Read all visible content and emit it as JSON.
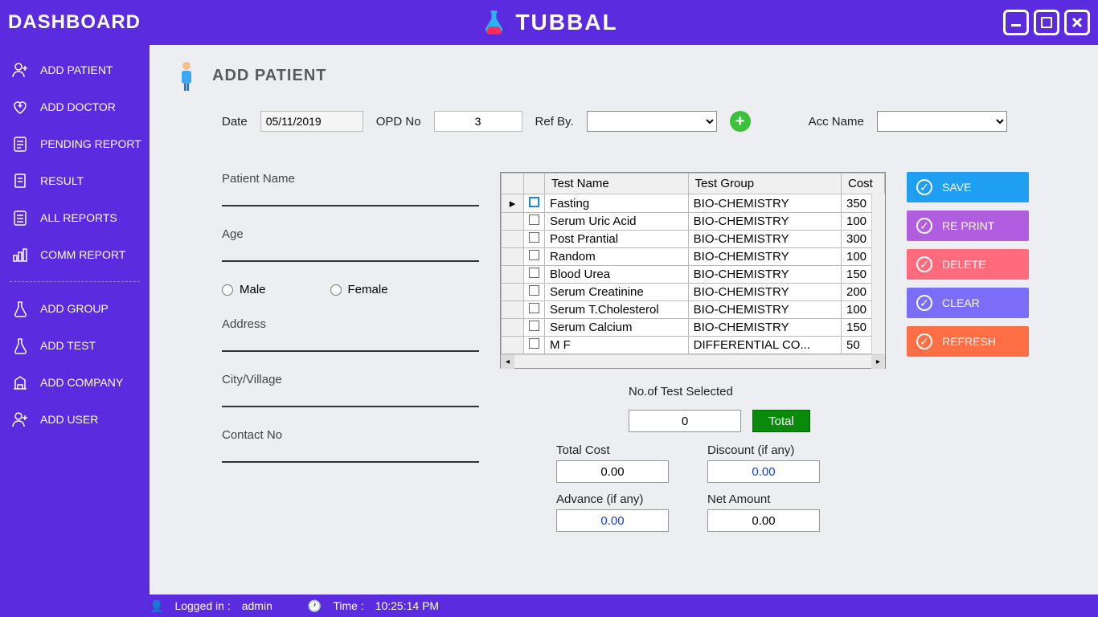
{
  "titlebar": {
    "dashboard": "DASHBOARD",
    "appname": "TUBBAL"
  },
  "sidebar": {
    "items": [
      {
        "label": "ADD PATIENT"
      },
      {
        "label": "ADD DOCTOR"
      },
      {
        "label": "PENDING REPORT"
      },
      {
        "label": "RESULT"
      },
      {
        "label": "ALL REPORTS"
      },
      {
        "label": "COMM REPORT"
      }
    ],
    "items2": [
      {
        "label": "ADD GROUP"
      },
      {
        "label": "ADD TEST"
      },
      {
        "label": "ADD COMPANY"
      },
      {
        "label": "ADD USER"
      }
    ]
  },
  "page": {
    "title": "ADD PATIENT"
  },
  "top": {
    "date_lbl": "Date",
    "date_val": "05/11/2019",
    "opd_lbl": "OPD No",
    "opd_val": "3",
    "refby_lbl": "Ref By.",
    "acc_lbl": "Acc Name"
  },
  "form": {
    "patient_name": "Patient Name",
    "age": "Age",
    "male": "Male",
    "female": "Female",
    "address": "Address",
    "city": "City/Village",
    "contact": "Contact No"
  },
  "grid": {
    "headers": {
      "name": "Test Name",
      "group": "Test Group",
      "cost": "Cost"
    },
    "rows": [
      {
        "name": "Fasting",
        "group": "BIO-CHEMISTRY",
        "cost": "350"
      },
      {
        "name": "Serum Uric Acid",
        "group": "BIO-CHEMISTRY",
        "cost": "100"
      },
      {
        "name": "Post Prantial",
        "group": "BIO-CHEMISTRY",
        "cost": "300"
      },
      {
        "name": "Random",
        "group": "BIO-CHEMISTRY",
        "cost": "100"
      },
      {
        "name": "Blood Urea",
        "group": "BIO-CHEMISTRY",
        "cost": "150"
      },
      {
        "name": "Serum Creatinine",
        "group": "BIO-CHEMISTRY",
        "cost": "200"
      },
      {
        "name": "Serum T.Cholesterol",
        "group": "BIO-CHEMISTRY",
        "cost": "100"
      },
      {
        "name": "Serum Calcium",
        "group": "BIO-CHEMISTRY",
        "cost": "150"
      },
      {
        "name": "M F",
        "group": "DIFFERENTIAL CO...",
        "cost": "50"
      }
    ]
  },
  "actions": {
    "save": "SAVE",
    "reprint": "RE PRINT",
    "delete": "DELETE",
    "clear": "CLEAR",
    "refresh": "REFRESH"
  },
  "calc": {
    "num_lbl": "No.of Test Selected",
    "num_val": "0",
    "total_btn": "Total",
    "totalcost_lbl": "Total Cost",
    "totalcost_val": "0.00",
    "discount_lbl": "Discount (if any)",
    "discount_val": "0.00",
    "advance_lbl": "Advance (if any)",
    "advance_val": "0.00",
    "net_lbl": "Net Amount",
    "net_val": "0.00"
  },
  "status": {
    "logged_lbl": "Logged in :",
    "logged_val": "admin",
    "time_lbl": "Time :",
    "time_val": "10:25:14 PM"
  }
}
